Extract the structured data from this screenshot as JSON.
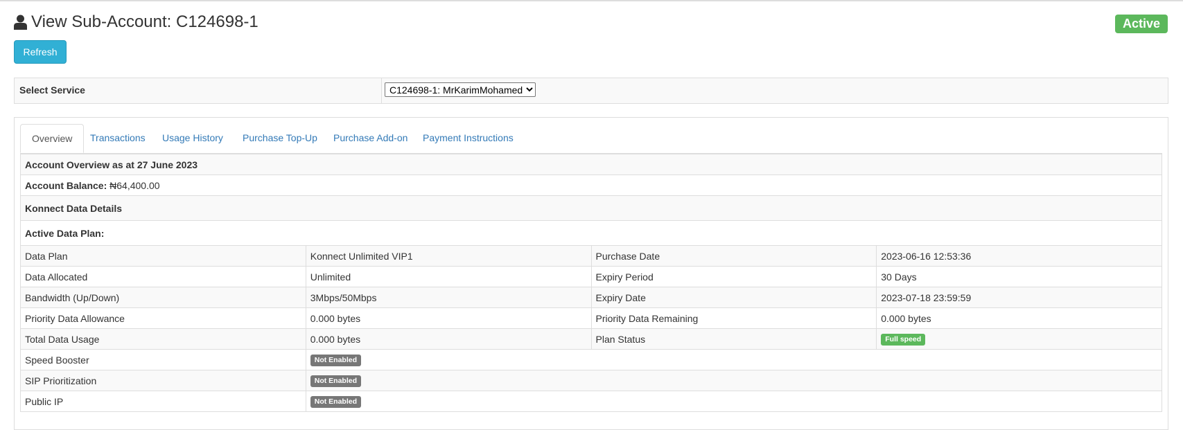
{
  "header": {
    "title": "View Sub-Account: C124698-1",
    "status": "Active",
    "refresh_label": "Refresh"
  },
  "service": {
    "label": "Select Service",
    "selected": "C124698-1: MrKarimMohamed"
  },
  "tabs": [
    "Overview",
    "Transactions",
    "Usage History",
    "Purchase Top-Up",
    "Purchase Add-on",
    "Payment Instructions"
  ],
  "overview": {
    "heading": "Account Overview as at 27 June 2023",
    "balance_label": "Account Balance:",
    "balance_value": "₦64,400.00",
    "data_details_heading": "Konnect Data Details",
    "active_plan_heading": "Active Data Plan:"
  },
  "plan_rows": [
    {
      "l1": "Data Plan",
      "v1": "Konnect Unlimited VIP1",
      "l2": "Purchase Date",
      "v2": "2023-06-16 12:53:36"
    },
    {
      "l1": "Data Allocated",
      "v1": "Unlimited",
      "l2": "Expiry Period",
      "v2": "30 Days"
    },
    {
      "l1": "Bandwidth (Up/Down)",
      "v1": "3Mbps/50Mbps",
      "l2": "Expiry Date",
      "v2": "2023-07-18 23:59:59"
    },
    {
      "l1": "Priority Data Allowance",
      "v1": "0.000 bytes",
      "l2": "Priority Data Remaining",
      "v2": "0.000 bytes"
    },
    {
      "l1": "Total Data Usage",
      "v1": "0.000 bytes",
      "l2": "Plan Status",
      "v2_badge": "Full speed"
    }
  ],
  "feature_rows": [
    {
      "label": "Speed Booster",
      "badge": "Not Enabled"
    },
    {
      "label": "SIP Prioritization",
      "badge": "Not Enabled"
    },
    {
      "label": "Public IP",
      "badge": "Not Enabled"
    }
  ],
  "colors": {
    "success": "#5cb85c",
    "info": "#31b0d5",
    "link": "#337ab7",
    "default_badge": "#777777"
  },
  "icons": {
    "title_icon": "user-icon"
  }
}
